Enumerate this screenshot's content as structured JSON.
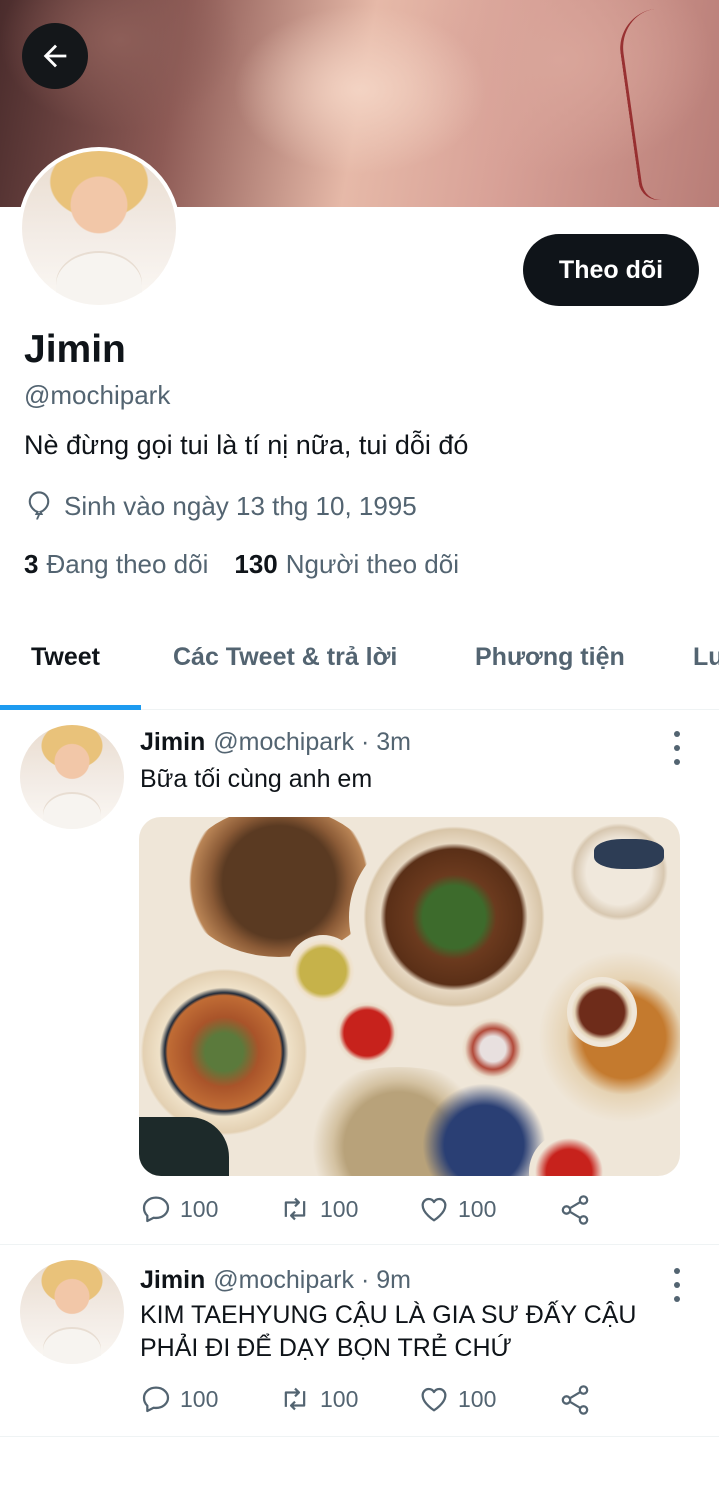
{
  "header": {
    "back_icon": "arrow-left-icon",
    "follow_label": "Theo dõi"
  },
  "profile": {
    "name": "Jimin",
    "handle": "@mochipark",
    "bio": "Nè đừng gọi tui là tí nị nữa, tui dỗi đó",
    "birth": "Sinh vào ngày 13 thg 10, 1995",
    "following_count": "3",
    "following_label": "Đang theo dõi",
    "followers_count": "130",
    "followers_label": "Người theo dõi"
  },
  "tabs": [
    {
      "label": "Tweet",
      "active": true
    },
    {
      "label": "Các Tweet & trả lời",
      "active": false
    },
    {
      "label": "Phương tiện",
      "active": false
    },
    {
      "label": "Lư",
      "active": false
    }
  ],
  "tweets": [
    {
      "name": "Jimin",
      "handle": "@mochipark",
      "time": "· 3m",
      "text": "Bữa tối cùng anh em",
      "has_media": true,
      "replies": "100",
      "retweets": "100",
      "likes": "100"
    },
    {
      "name": "Jimin",
      "handle": "@mochipark",
      "time": "· 9m",
      "text": "KIM TAEHYUNG CẬU LÀ GIA SƯ ĐẤY CẬU PHẢI ĐI ĐỂ DẠY BỌN TRẺ CHỨ",
      "has_media": false,
      "replies": "100",
      "retweets": "100",
      "likes": "100"
    }
  ],
  "colors": {
    "accent": "#1d9bf0",
    "text_primary": "#0f1419",
    "text_secondary": "#536471",
    "button_bg": "#0f1419"
  }
}
